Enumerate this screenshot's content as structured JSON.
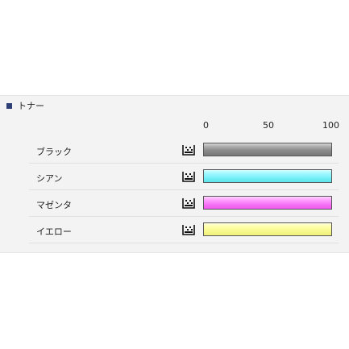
{
  "section": {
    "title": "トナー"
  },
  "scale": {
    "labels": [
      "0",
      "50",
      "100"
    ]
  },
  "toners": [
    {
      "name": "ブラック",
      "level_percent": 100,
      "color": "#8c8c8c",
      "icon": "toner-cartridge-icon"
    },
    {
      "name": "シアン",
      "level_percent": 100,
      "color": "#70eef4",
      "icon": "toner-cartridge-icon"
    },
    {
      "name": "マゼンタ",
      "level_percent": 100,
      "color": "#f46df4",
      "icon": "toner-cartridge-icon"
    },
    {
      "name": "イエロー",
      "level_percent": 100,
      "color": "#f6f68a",
      "icon": "toner-cartridge-icon"
    }
  ]
}
